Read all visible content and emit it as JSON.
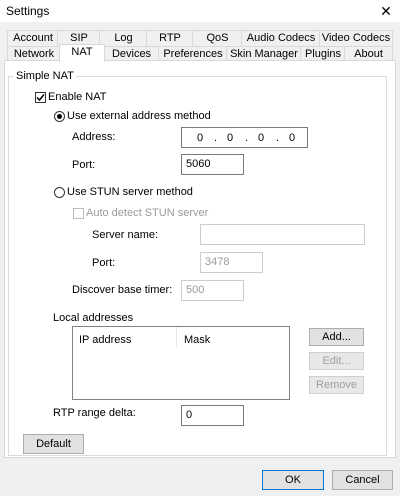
{
  "window": {
    "title": "Settings",
    "close_glyph": "✕"
  },
  "tabs_row1": [
    "Account",
    "SIP",
    "Log",
    "RTP",
    "QoS",
    "Audio Codecs",
    "Video Codecs"
  ],
  "tabs_row2": [
    "Network",
    "NAT",
    "Devices",
    "Preferences",
    "Skin Manager",
    "Plugins",
    "About"
  ],
  "active_tab": "NAT",
  "simple_nat": {
    "group_label": "Simple NAT",
    "enable_nat_label": "Enable NAT",
    "enable_nat_checked": true,
    "external_method_label": "Use external address method",
    "external_method_selected": true,
    "address_label": "Address:",
    "address_octets": [
      "0",
      "0",
      "0",
      "0"
    ],
    "port_label": "Port:",
    "port_value": "5060",
    "stun_method_label": "Use STUN server method",
    "stun_method_selected": false,
    "auto_detect_label": "Auto detect STUN server",
    "auto_detect_checked": false,
    "server_name_label": "Server name:",
    "server_name_value": "",
    "stun_port_label": "Port:",
    "stun_port_value": "3478",
    "discover_timer_label": "Discover base timer:",
    "discover_timer_value": "500",
    "local_addresses_label": "Local addresses",
    "columns": [
      "IP address",
      "Mask"
    ],
    "add_label": "Add...",
    "edit_label": "Edit...",
    "remove_label": "Remove",
    "rtp_range_label": "RTP range delta:",
    "rtp_range_value": "0"
  },
  "footer": {
    "default_label": "Default",
    "ok_label": "OK",
    "cancel_label": "Cancel"
  }
}
